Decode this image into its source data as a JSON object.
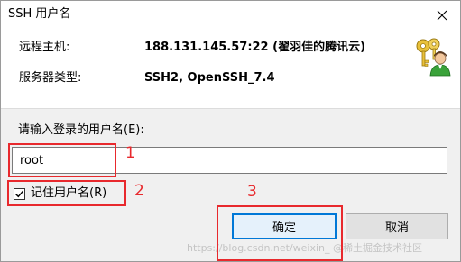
{
  "window": {
    "title": "SSH 用户名",
    "close_glyph": "✕"
  },
  "info": {
    "host_label": "远程主机:",
    "host_value": "188.131.145.57:22 (翟羽佳的腾讯云)",
    "server_type_label": "服务器类型:",
    "server_type_value": "SSH2, OpenSSH_7.4",
    "icon": "keys-user-icon"
  },
  "form": {
    "prompt": "请输入登录的用户名(E):",
    "username_value": "root",
    "remember_label": "记住用户名(R)",
    "remember_checked": true
  },
  "buttons": {
    "ok_label": "确定",
    "cancel_label": "取消"
  },
  "annotations": {
    "color": "#e8292d",
    "labels": [
      "1",
      "2",
      "3"
    ]
  },
  "watermark": "https://blog.csdn.net/weixin_ @稀土掘金技术社区"
}
